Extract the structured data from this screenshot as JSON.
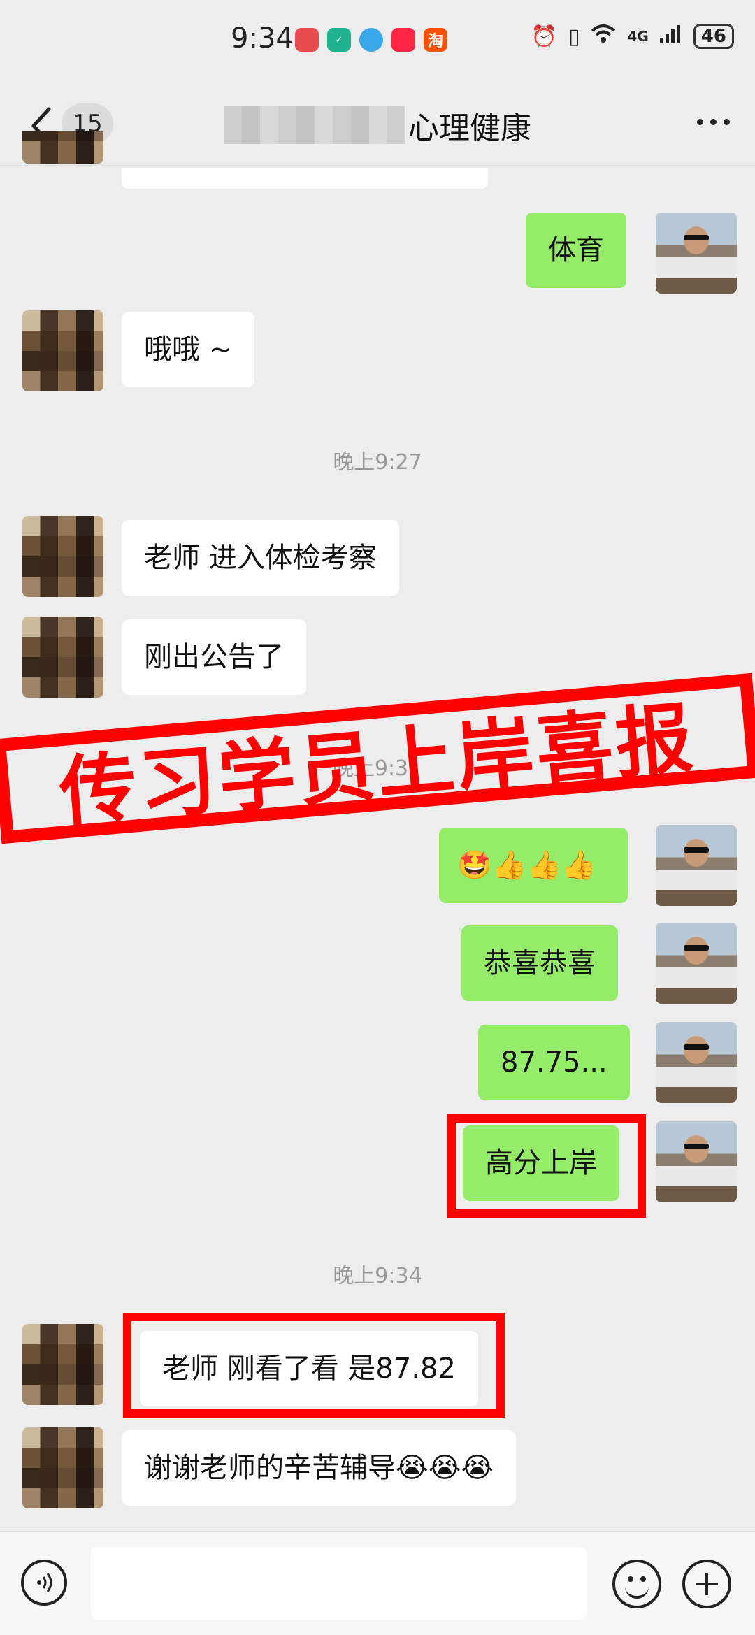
{
  "status_bar": {
    "time": "9:34",
    "network": "4G",
    "battery": "46"
  },
  "header": {
    "unread_count": "15",
    "title": "心理健康"
  },
  "messages": {
    "m1": "体育",
    "m2": "哦哦 ~",
    "m3": "老师 进入体检考察",
    "m4": "刚出公告了",
    "m5": "🤩👍👍👍",
    "m6": "恭喜恭喜",
    "m7": "87.75...",
    "m8": "高分上岸",
    "m9": "老师 刚看了看 是87.82",
    "m10": "谢谢老师的辛苦辅导😭😭😭"
  },
  "timestamps": {
    "t1": "晚上9:27",
    "t2": "晚上9:3",
    "t3": "晚上9:34"
  },
  "stamp": {
    "text": "传习学员上岸喜报"
  },
  "colors": {
    "accent_red": "#ff0000",
    "out_bubble": "#95ec69"
  }
}
